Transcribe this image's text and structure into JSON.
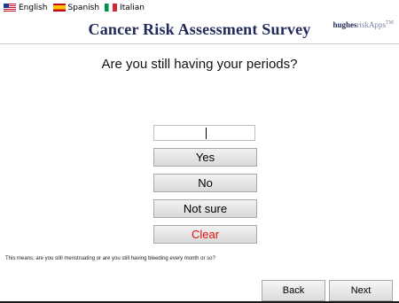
{
  "languages": [
    {
      "label": "English",
      "flag": "us-flag-icon"
    },
    {
      "label": "Spanish",
      "flag": "spain-flag-icon"
    },
    {
      "label": "Italian",
      "flag": "italy-flag-icon"
    }
  ],
  "header": {
    "title": "Cancer Risk Assessment Survey",
    "brand_part1": "hughes",
    "brand_part2": "riskApps",
    "brand_tm": "TM"
  },
  "question": "Are you still having your periods?",
  "answer_value": "",
  "options": {
    "yes": "Yes",
    "no": "No",
    "not_sure": "Not sure",
    "clear": "Clear"
  },
  "hint": "This means: are you still menstruating or are you still having bleeding every month or so?",
  "nav": {
    "back": "Back",
    "next": "Next"
  },
  "colors": {
    "title": "#1f2a5a",
    "clear_text": "#e01010",
    "button_bg_top": "#f2f2f2",
    "button_bg_bottom": "#d9d9d9"
  }
}
